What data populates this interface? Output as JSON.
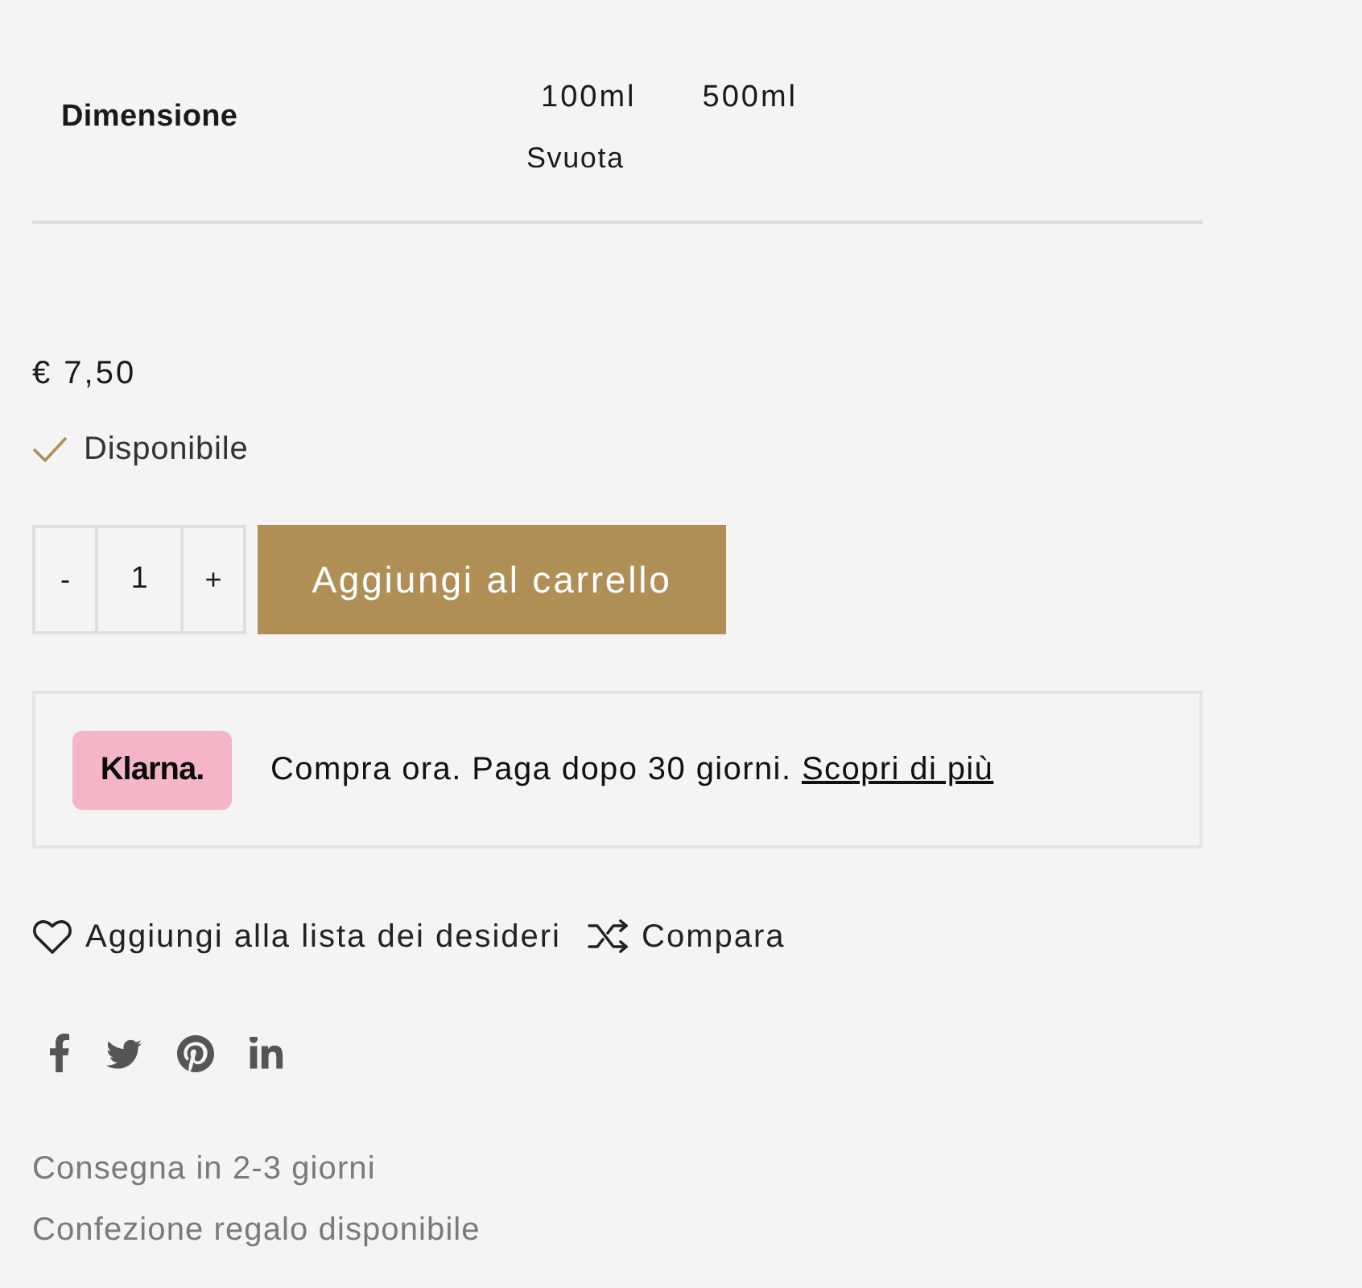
{
  "variations": [
    {
      "label": "Dimensione",
      "options": [
        {
          "label": "100ml"
        },
        {
          "label": "500ml"
        }
      ],
      "reset": "Svuota"
    }
  ],
  "price": "€ 7,50",
  "availability": "Disponibile",
  "quantity": {
    "decrement": "-",
    "value": "1",
    "increment": "+"
  },
  "add_to_cart": "Aggiungi al carrello",
  "klarna": {
    "logo": "Klarna.",
    "text": "Compra ora. Paga dopo 30 giorni.",
    "link": "Scopri di più"
  },
  "actions": [
    {
      "kind": "wishlist",
      "label": "Aggiungi alla lista dei desideri"
    },
    {
      "kind": "compare",
      "label": "Compara"
    }
  ],
  "delivery_notes": [
    "Consegna in 2-3 giorni",
    "Confezione regalo disponibile"
  ]
}
